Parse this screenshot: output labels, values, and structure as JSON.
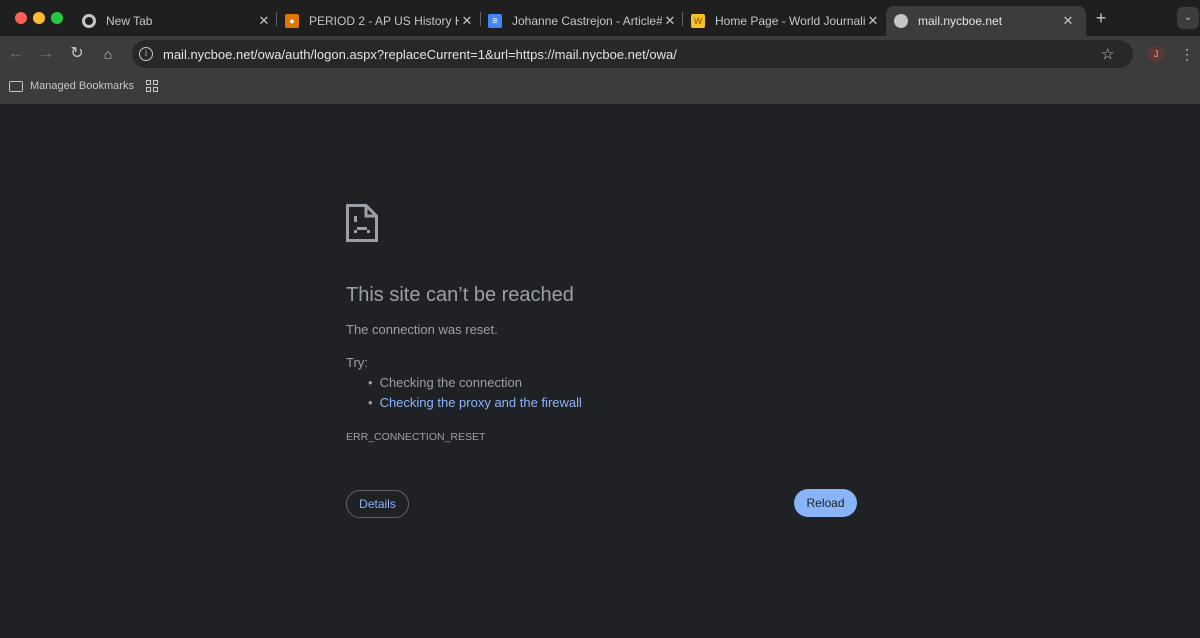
{
  "tabs": [
    {
      "title": "New Tab",
      "icon": "chrome-icon"
    },
    {
      "title": "PERIOD 2 - AP US History HU",
      "icon": "classroom-icon"
    },
    {
      "title": "Johanne Castrejon - Article#",
      "icon": "docs-icon"
    },
    {
      "title": "Home Page - World Journalis",
      "icon": "w-icon",
      "icon_letter": "W"
    },
    {
      "title": "mail.nycboe.net",
      "icon": "globe-icon",
      "active": true
    }
  ],
  "toolbar": {
    "url": "mail.nycboe.net/owa/auth/logon.aspx?replaceCurrent=1&url=https://mail.nycboe.net/owa/",
    "profile_initial": "J"
  },
  "bookmarks": {
    "managed": "Managed Bookmarks"
  },
  "error": {
    "title": "This site can’t be reached",
    "message": "The connection was reset.",
    "try_label": "Try:",
    "suggestions": [
      "Checking the connection",
      "Checking the proxy and the firewall"
    ],
    "code": "ERR_CONNECTION_RESET",
    "details_label": "Details",
    "reload_label": "Reload"
  },
  "colors": {
    "accent": "#8ab4f8",
    "page_bg": "#202124",
    "link": "#8ab4f8"
  }
}
